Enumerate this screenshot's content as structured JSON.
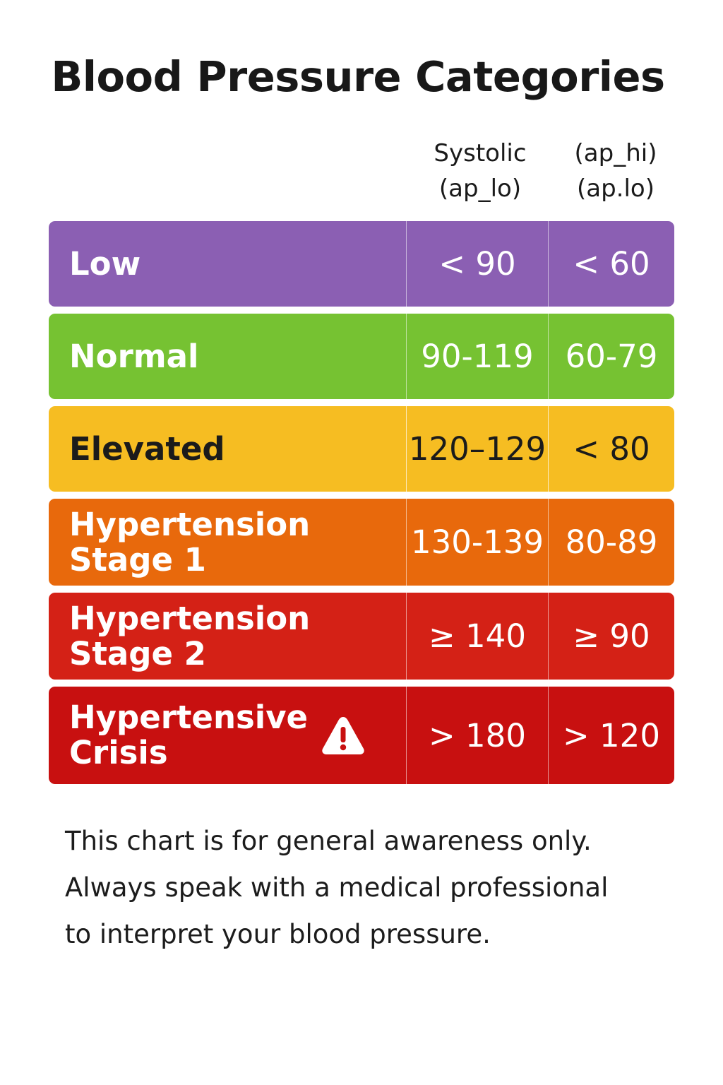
{
  "title": "Blood Pressure Categories",
  "column_headers": {
    "systolic": [
      "Systolic",
      "(ap_lo)"
    ],
    "diastolic": [
      "(ap_hi)",
      "(ap.lo)"
    ]
  },
  "colors": {
    "low": "#8b5fb3",
    "normal": "#76c232",
    "elevated": "#f6bd22",
    "stage1": "#e8690c",
    "stage2": "#d42116",
    "crisis": "#c81010"
  },
  "chart_data": {
    "type": "table",
    "title": "Blood Pressure Categories",
    "columns": [
      "",
      "Systolic (ap_lo)",
      "(ap_hi) (ap.lo)"
    ],
    "rows": [
      {
        "category": "Low",
        "systolic": "< 90",
        "diastolic": "< 60",
        "color": "#8b5fb3",
        "text_color": "#ffffff"
      },
      {
        "category": "Normal",
        "systolic": "90-119",
        "diastolic": "60-79",
        "color": "#76c232",
        "text_color": "#ffffff"
      },
      {
        "category": "Elevated",
        "systolic": "120–129",
        "diastolic": "< 80",
        "color": "#f6bd22",
        "text_color": "#1b1b1b"
      },
      {
        "category": "Hypertension\nStage 1",
        "systolic": "130-139",
        "diastolic": "80-89",
        "color": "#e8690c",
        "text_color": "#ffffff"
      },
      {
        "category": "Hypertension\nStage 2",
        "systolic": "≥ 140",
        "diastolic": "≥ 90",
        "color": "#d42116",
        "text_color": "#ffffff"
      },
      {
        "category": "Hypertensive\nCrisis",
        "systolic": "> 180",
        "diastolic": "> 120",
        "color": "#c81010",
        "text_color": "#ffffff",
        "icon": "warning-icon"
      }
    ]
  },
  "footnote": [
    "This chart is for general awareness only.",
    "Always speak with a medical professional",
    "to interpret your blood pressure."
  ]
}
